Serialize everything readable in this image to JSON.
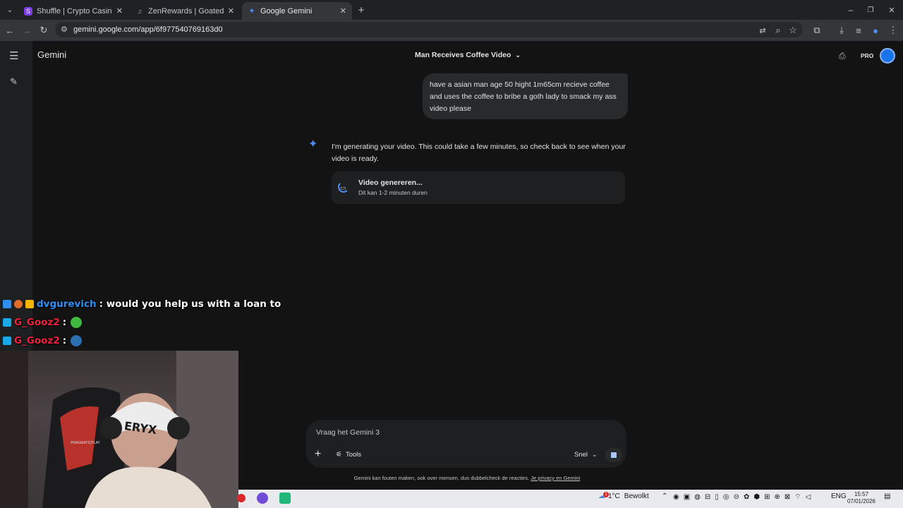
{
  "browser": {
    "tabs": [
      {
        "title": "Shuffle | Crypto Casino & Bitcoin",
        "active": false
      },
      {
        "title": "ZenRewards | Goated Leaderboard",
        "active": false
      },
      {
        "title": "Google Gemini",
        "active": true
      }
    ],
    "url": "gemini.google.com/app/6f977540769163d0"
  },
  "gemini": {
    "brand": "Gemini",
    "conversation_title": "Man Receives Coffee Video",
    "plan_badge": "PRO",
    "user_message": "have a asian man age 50 hight 1m65cm recieve coffee and uses the coffee to bribe a goth lady to smack my ass video please",
    "response_text": "I'm generating your video. This could take a few minutes, so check back to see when your video is ready.",
    "gen_card": {
      "title": "Video genereren...",
      "subtitle": "Dit kan 1-2 minuten duren"
    },
    "composer": {
      "placeholder": "Vraag het Gemini 3",
      "tools_label": "Tools",
      "mode_label": "Snel"
    },
    "disclaimer": "Gemini kan fouten maken, ook over mensen, dus dubbelcheck de reacties.",
    "disclaimer_link": "Je privacy en Gemini"
  },
  "chat": [
    {
      "user": "dvgurevich",
      "user_color": "#2f8ff5",
      "message": ": would you help us with a loan to"
    },
    {
      "user": "G_Gooz2",
      "user_color": "#f0223c",
      "message": ":"
    },
    {
      "user": "G_Gooz2",
      "user_color": "#f0223c",
      "message": ":"
    }
  ],
  "webcam": {
    "headband_text": "ERYX",
    "chair_text": "PRAGMATICPLAY"
  },
  "taskbar": {
    "weather": "1°C",
    "weather_desc": "Bewolkt",
    "language": "ENG",
    "time": "15:57",
    "date": "07/01/2026",
    "weather_badge": "1"
  },
  "colors": {
    "accent": "#4c8df6",
    "bg": "#131314",
    "surface": "#1e1f20"
  }
}
